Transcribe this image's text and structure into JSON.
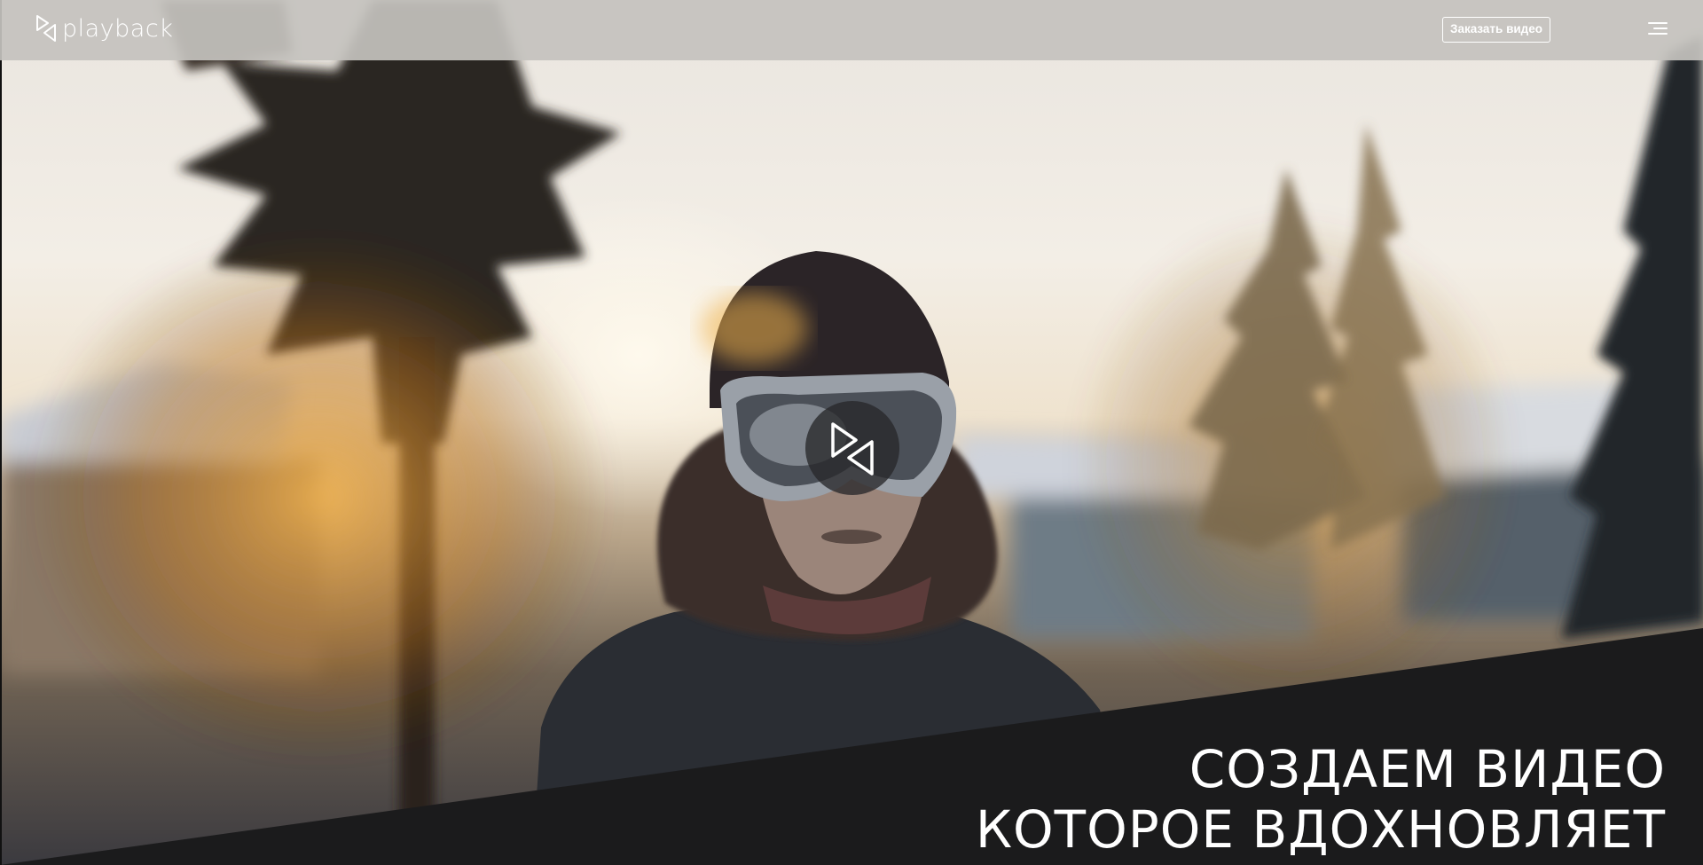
{
  "brand": {
    "name": "playback",
    "logo_icon": "playback-logo-icon"
  },
  "header": {
    "order_button_label": "Заказать видео",
    "menu_icon": "hamburger-menu-icon"
  },
  "hero": {
    "play_icon": "play-logo-icon",
    "headline_line1": "СОЗДАЕМ ВИДЕО",
    "headline_line2": "КОТОРОЕ ВДОХНОВЛЯЕТ"
  },
  "colors": {
    "header_bg": "#c4c2be",
    "dark_band": "#1b1b1c",
    "text": "#ffffff"
  }
}
